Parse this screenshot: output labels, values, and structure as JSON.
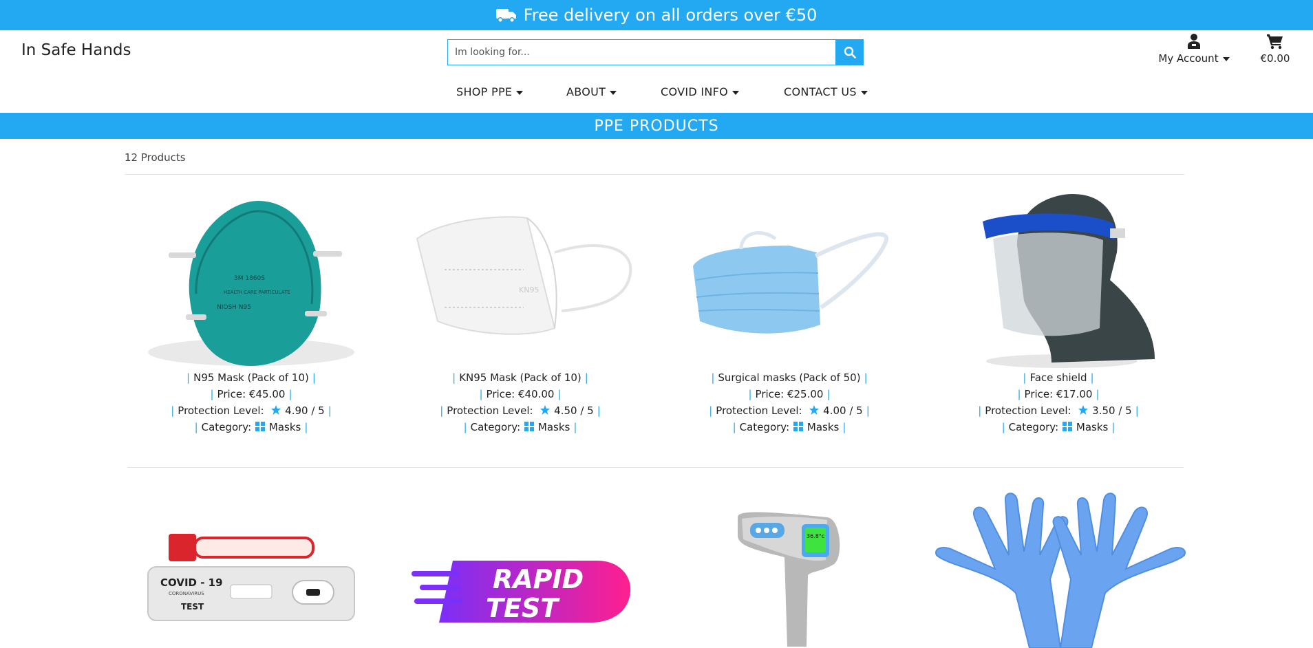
{
  "banner": {
    "text": "Free delivery on all orders over €50",
    "icon": "truck-icon"
  },
  "brand": "In Safe Hands",
  "search": {
    "placeholder": "Im looking for...",
    "icon": "search-icon"
  },
  "account": {
    "label": "My Account",
    "icon": "user-icon"
  },
  "cart": {
    "total": "€0.00",
    "icon": "cart-icon"
  },
  "nav": [
    "SHOP PPE",
    "ABOUT",
    "COVID INFO",
    "CONTACT US"
  ],
  "section_title": "PPE PRODUCTS",
  "product_count": "12 Products",
  "labels": {
    "price": "Price:",
    "protection": "Protection Level:",
    "category": "Category:"
  },
  "products": [
    {
      "name": "N95 Mask (Pack of 10)",
      "price": "€45.00",
      "rating": "4.90 / 5",
      "category": "Masks"
    },
    {
      "name": "KN95 Mask (Pack of 10)",
      "price": "€40.00",
      "rating": "4.50 / 5",
      "category": "Masks"
    },
    {
      "name": "Surgical masks (Pack of 50)",
      "price": "€25.00",
      "rating": "4.00 / 5",
      "category": "Masks"
    },
    {
      "name": "Face shield",
      "price": "€17.00",
      "rating": "3.50 / 5",
      "category": "Masks"
    }
  ],
  "second_row_images": {
    "test_kit_label": "COVID - 19",
    "test_kit_sub": "CORONAVIRUS",
    "test_kit_test": "TEST",
    "rapid_test": [
      "RAPID",
      "TEST"
    ],
    "thermometer_reading": "36.8°c"
  },
  "colors": {
    "accent": "#22a9f2"
  }
}
